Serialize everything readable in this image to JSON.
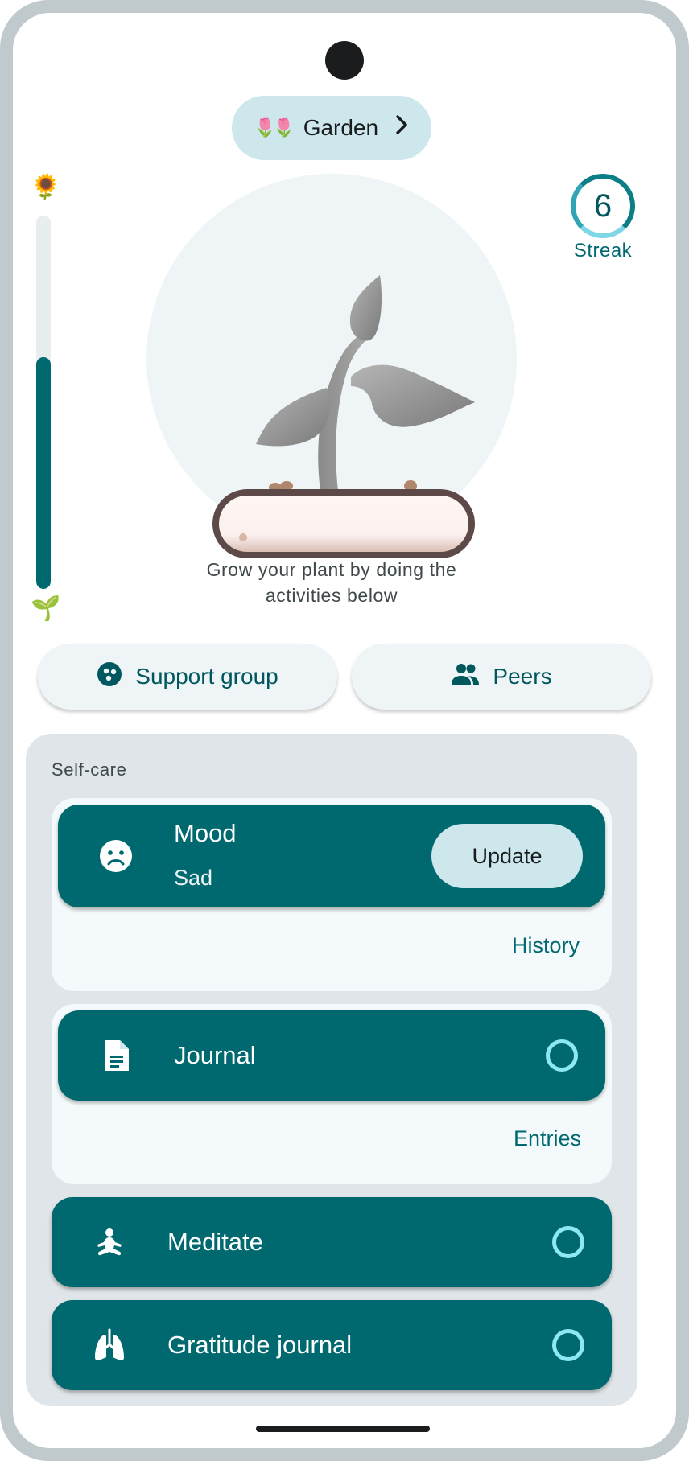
{
  "header": {
    "garden_label": "Garden",
    "garden_icon": "🌷🌷",
    "chevron": "›"
  },
  "progress": {
    "top_icon": "🌻",
    "bottom_icon": "🌱",
    "fill_fraction": 0.62
  },
  "streak": {
    "value": "6",
    "label": "Streak"
  },
  "plant": {
    "caption": "Grow your plant by doing the activities below"
  },
  "social": {
    "support_group_label": "Support group",
    "peers_label": "Peers"
  },
  "selfcare": {
    "title": "Self-care",
    "mood": {
      "title": "Mood",
      "value": "Sad",
      "update_label": "Update",
      "history_label": "History"
    },
    "journal": {
      "title": "Journal",
      "entries_label": "Entries"
    },
    "meditate": {
      "title": "Meditate"
    },
    "gratitude": {
      "title": "Gratitude journal"
    }
  },
  "colors": {
    "primary": "#00696f",
    "accent_ring": "#8ee8f2",
    "chip": "#cde7ec",
    "panel": "#dfe5e8"
  },
  "icons": [
    "flower-icon",
    "chevron-right-icon",
    "sunflower-icon",
    "sprout-icon",
    "support-group-icon",
    "people-icon",
    "sad-face-icon",
    "document-icon",
    "meditation-icon",
    "lungs-icon",
    "circle-outline-icon"
  ]
}
